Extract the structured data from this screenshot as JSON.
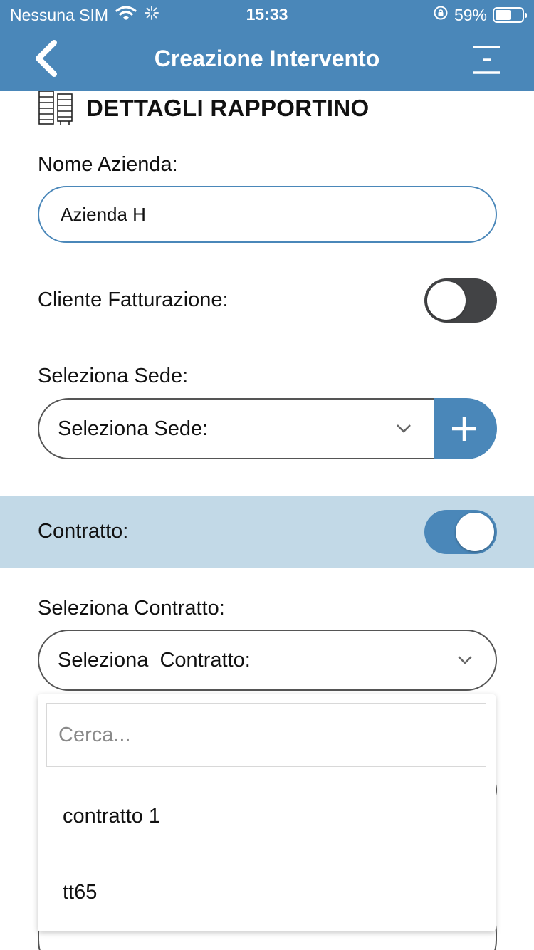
{
  "status_bar": {
    "carrier": "Nessuna SIM",
    "time": "15:33",
    "battery": "59%",
    "battery_level": 0.59
  },
  "header": {
    "title": "Creazione Intervento"
  },
  "section": {
    "title": "DETTAGLI RAPPORTINO"
  },
  "form": {
    "nome_azienda_label": "Nome Azienda:",
    "nome_azienda_value": "Azienda H",
    "cliente_fatturazione_label": "Cliente Fatturazione:",
    "cliente_fatturazione_on": false,
    "seleziona_sede_label": "Seleziona Sede:",
    "seleziona_sede_value": "Seleziona Sede:",
    "contratto_label": "Contratto:",
    "contratto_on": true,
    "seleziona_contratto_label": "Seleziona  Contratto:",
    "seleziona_contratto_value": "Seleziona  Contratto:"
  },
  "dropdown": {
    "search_placeholder": "Cerca...",
    "options": [
      "contratto 1",
      "tt65"
    ]
  },
  "colors": {
    "primary": "#4a87b9",
    "band": "#c2d9e7",
    "toggle_off": "#424345"
  }
}
